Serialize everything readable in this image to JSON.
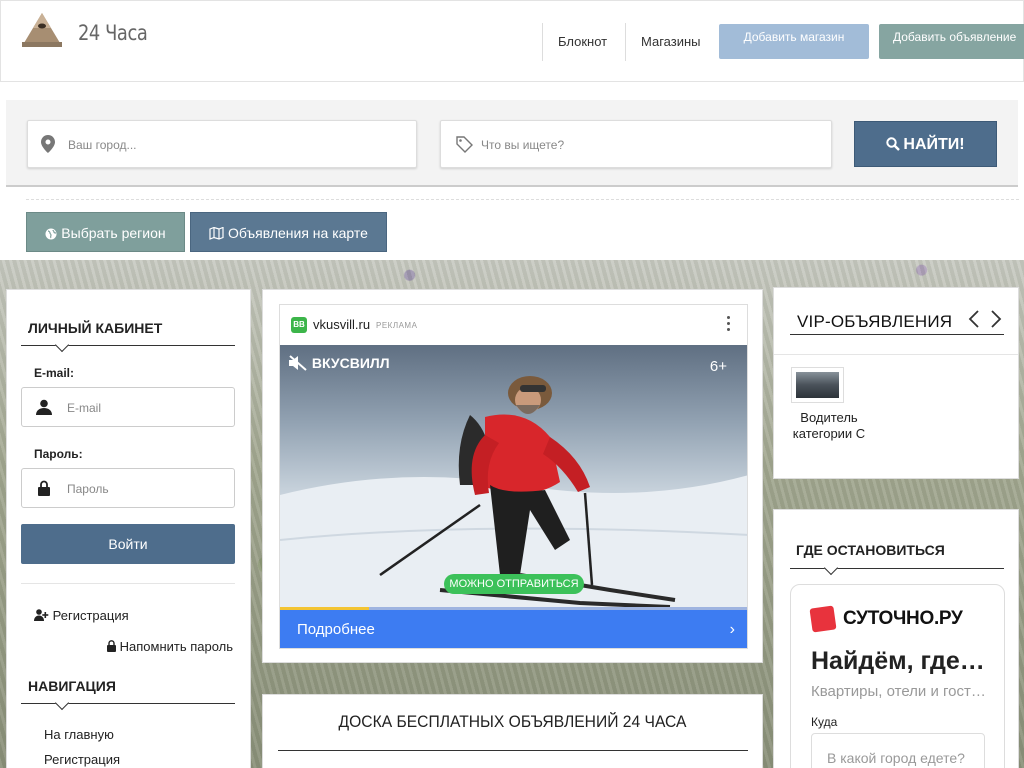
{
  "header": {
    "site_name": "24 Часа",
    "nav": [
      {
        "label": "Блокнот"
      },
      {
        "label": "Магазины"
      }
    ],
    "add_shop_label": "Добавить магазин",
    "add_ad_label": "Добавить объявление"
  },
  "search": {
    "city_placeholder": "Ваш город...",
    "query_placeholder": "Что вы ищете?",
    "submit_label": "НАЙТИ!"
  },
  "actions": {
    "region_label": "Выбрать регион",
    "map_label": "Объявления на карте"
  },
  "account": {
    "title": "Личный кабинет",
    "email_label": "E-mail:",
    "email_placeholder": "E-mail",
    "password_label": "Пароль:",
    "password_placeholder": "Пароль",
    "login_label": "Войти",
    "register_label": "Регистрация",
    "remind_label": "Напомнить пароль"
  },
  "navigation": {
    "title": "Навигация",
    "items": [
      {
        "label": "На главную"
      },
      {
        "label": "Регистрация"
      }
    ]
  },
  "ad": {
    "badge": "ВВ",
    "domain": "vkusvill.ru",
    "tag": "РЕКЛАМА",
    "brand": "ВКУСВИЛЛ",
    "age": "6+",
    "cta_pill": "МОЖНО ОТПРАВИТЬСЯ",
    "more_label": "Подробнее",
    "progress": 0.19
  },
  "board": {
    "title": "ДОСКА БЕСПЛАТНЫХ ОБЪЯВЛЕНИЙ 24 ЧАСА"
  },
  "vip": {
    "title": "VIP-ОБЪЯВЛЕНИЯ",
    "items": [
      {
        "caption": "Водитель категории С"
      }
    ]
  },
  "stay": {
    "title": "Где остановиться",
    "logo": "СУТОЧНО.РУ",
    "heading": "Найдём, где остановиться",
    "subheading": "Квартиры, отели и гостиницы",
    "where_label": "Куда",
    "where_placeholder": "В какой город едете?"
  },
  "colors": {
    "primary": "#4e6d8c",
    "teal": "#7f9f9c",
    "ad_blue": "#3d7cf2",
    "ad_green": "#3cc15a",
    "brand_red": "#e8333d"
  }
}
